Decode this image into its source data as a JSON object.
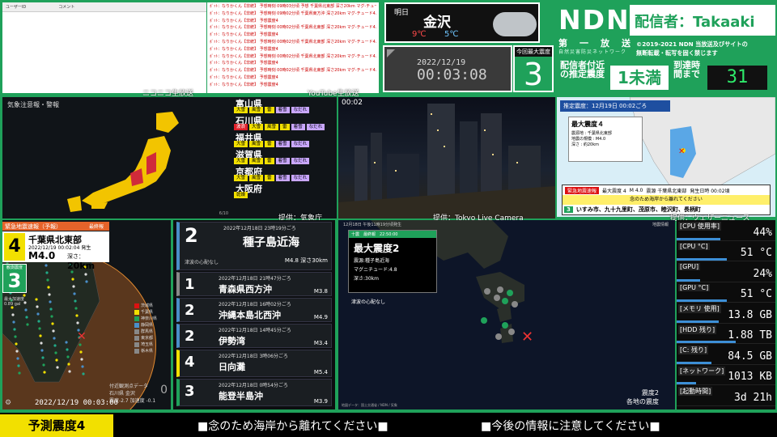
{
  "comments": {
    "col_user": "ユーザーID",
    "col_comment": "コメント"
  },
  "youtube_feed": [
    "ﾎﾞｯﾄ：なりかくん【非統】 予想時刻 09時03分頃 予想 千葉県北東部 深さ20km マグ-チュード4.0",
    "ﾎﾞｯﾄ：なりかくん【非統】 予想時刻 09時02分頃 千葉県東方沖 深さ20km マグ-チュード4.1",
    "ﾎﾞｯﾄ：なりかくん【非統】 予想震度4",
    "ﾎﾞｯﾄ：なりかくん【非統】 予想時刻 00時02分頃 千葉県北東部 深さ20km マグ-チュード4.0",
    "ﾎﾞｯﾄ：なりかくん【非統】 予想震度4",
    "ﾎﾞｯﾄ：なりかくん【非統】 予想時刻 00時02分頃 千葉県北東部 深さ20km マグ-チュード4.0",
    "ﾎﾞｯﾄ：なりかくん【非統】 予想震度4",
    "ﾎﾞｯﾄ：なりかくん【非統】 予想時刻 00時02分頃 千葉県北東部 深さ20km マグ-チュード4.0",
    "ﾎﾞｯﾄ：なりかくん【非統】 予想震度4",
    "ﾎﾞｯﾄ：なりかくん【非統】 予想時刻 00時02分頃 千葉県北東部 深さ20km マグ-チュード4.0",
    "ﾎﾞｯﾄ：なりかくん【非統】 予想震度4",
    "ﾎﾞｯﾄ：なりかくん【非統】 予想震度4"
  ],
  "weather": {
    "day": "明日",
    "city": "金沢",
    "high": "9℃",
    "low": "5℃"
  },
  "clock": {
    "date": "2022/12/19",
    "time": "00:03:08"
  },
  "max_intensity": {
    "label": "今回最大震度",
    "value": "3"
  },
  "ndn": {
    "logo": "NDN",
    "caster": "配信者：Takaaki",
    "sub": "第　一　放　送",
    "sub2": "自然災害防災ネットワーク",
    "copy1": "©2019-2021 NDN 当放送及びサイトの",
    "copy2": "無断転載・転写を固く禁じます",
    "est_label": "配信者付近の推定震度",
    "est_value": "1未満",
    "arr_label": "到達時間まで",
    "arr_value": "31"
  },
  "jmap": {
    "title": "気象注意報・警報",
    "page": "6/10",
    "credit_niconico": "ニコニコ生放送",
    "credit_youtube": "YouTube生放送",
    "credit_source": "提供：気象庁",
    "prefs": [
      {
        "name": "富山県",
        "tags": [
          "大雪",
          "風雪",
          "雷",
          "着雪",
          "なだれ"
        ]
      },
      {
        "name": "石川県",
        "tags": [
          "波浪",
          "大雪",
          "風雪",
          "雷",
          "着雪",
          "なだれ"
        ]
      },
      {
        "name": "福井県",
        "tags": [
          "大雪",
          "風雪",
          "雷",
          "着雪",
          "なだれ"
        ]
      },
      {
        "name": "滋賀県",
        "tags": [
          "大雪",
          "風雪",
          "雷",
          "着雪",
          "なだれ"
        ]
      },
      {
        "name": "京都府",
        "tags": [
          "大雪",
          "風雪",
          "雷",
          "着雪",
          "なだれ"
        ]
      },
      {
        "name": "大阪府",
        "tags": [
          "乾燥"
        ]
      }
    ]
  },
  "camera": {
    "time": "00:02",
    "credit": "提供：Tokyo Live Camera"
  },
  "eew_right": {
    "header": "推定震度：12月19日 00:02ごろ",
    "max": "最大震度４",
    "l1": "震源地 : 千葉県北東部",
    "l2": "地震の規模 : M4.0",
    "l3": "深さ : 約20km",
    "label": "緊急地震速報",
    "bar_max": "最大震度 4",
    "bar_m": "M 4.0",
    "bar_epi": "震源 千葉県北東部",
    "bar_time": "発生日時 00:02頃",
    "notice": "念のため海岸から離れてください",
    "int3": "3",
    "areas": "いすみ市、九十九里町、茂原市、睦沢町、長柄町",
    "credit": "提供：ウェザーニュース"
  },
  "eew_left": {
    "header": "緊急地震速報（予報）",
    "final": "最終報",
    "int_label": "予想最大震度",
    "intensity": "4",
    "epicenter": "千葉県北東部",
    "datetime": "2022/12/19 00:02:04 発生",
    "mag": "M4.0",
    "depth_label": "深さ：",
    "depth": "20km",
    "obs_label": "観測震度",
    "observed": "3",
    "max_accel_label": "最大加速度",
    "max_accel": "0.89 gal",
    "timestamp": "2022/12/19 00:03:00",
    "station1": "石川県 金沢",
    "station2": "震度-2.7 加速度 -0.1",
    "nearby": "付近観測点データ",
    "zero": "0",
    "list": [
      "茨城県",
      "千葉県",
      "神奈川県",
      "静岡県",
      "群馬県",
      "東京都",
      "埼玉県",
      "栃木県"
    ]
  },
  "history": [
    {
      "int": "2",
      "date": "2022年12月18日 23時19分ごろ",
      "place": "種子島近海",
      "mag": "M4.8 深さ30km",
      "tsunami": "津波の心配なし",
      "color": "#4a8ec9"
    },
    {
      "int": "1",
      "date": "2022年12月18日 21時47分ごろ",
      "place": "青森県西方沖",
      "mag": "M3.8",
      "color": "#888"
    },
    {
      "int": "2",
      "date": "2022年12月18日 16時02分ごろ",
      "place": "沖縄本島北西沖",
      "mag": "M4.9",
      "color": "#4a8ec9"
    },
    {
      "int": "2",
      "date": "2022年12月18日 14時45分ごろ",
      "place": "伊勢湾",
      "mag": "M3.4",
      "color": "#4a8ec9"
    },
    {
      "int": "4",
      "date": "2022年12月18日 3時06分ごろ",
      "place": "日向灘",
      "mag": "M5.4",
      "color": "#f2e000"
    },
    {
      "int": "3",
      "date": "2022年12月18日 0時54分ごろ",
      "place": "能登半島沖",
      "mag": "M3.9",
      "color": "#1fa15a"
    }
  ],
  "tmap": {
    "top": "12月18日 午後11時19分頃発生",
    "tr": "地震情報",
    "card_head": "十震　最終報　22:50:00",
    "card_big": "最大震度2",
    "card_l1": "震源:種子島近海",
    "card_l2": "マグニチュード:4.8",
    "card_l3": "深さ:30km",
    "note": "津波の心配なし",
    "legend1": "震度2",
    "legend2": "各地の震度",
    "foot": "地図データ：国土交通省 / NDN / 気象"
  },
  "system": [
    {
      "k": "[CPU 使用率]",
      "v": "44%",
      "p": 0.44
    },
    {
      "k": "[CPU °C]",
      "v": "51 °C",
      "p": 0.51
    },
    {
      "k": "[GPU]",
      "v": "24%",
      "p": 0.24
    },
    {
      "k": "[GPU °C]",
      "v": "51 °C",
      "p": 0.51
    },
    {
      "k": "[メモリ 使用]",
      "v": "13.8 GB",
      "p": 0.43
    },
    {
      "k": "[HDD 残り]",
      "v": "1.88 TB",
      "p": 0.6
    },
    {
      "k": "[C: 残り]",
      "v": "84.5 GB",
      "p": 0.35
    },
    {
      "k": "[ネットワーク]",
      "v": "1013 KB",
      "p": 0.2
    },
    {
      "k": "[起動時間]",
      "v": "3d 21h",
      "p": 0
    }
  ],
  "ticker": {
    "label": "予測震度4",
    "msg1": "■念のため海岸から離れてください■",
    "msg2": "■今後の情報に注意してください■"
  }
}
